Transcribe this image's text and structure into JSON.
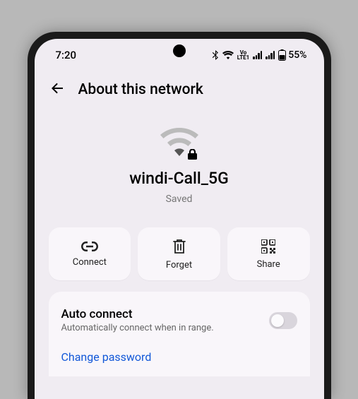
{
  "statusbar": {
    "time": "7:20",
    "battery_pct": "55%"
  },
  "header": {
    "title": "About this network"
  },
  "network": {
    "name": "windi-Call_5G",
    "status": "Saved"
  },
  "actions": {
    "connect": "Connect",
    "forget": "Forget",
    "share": "Share"
  },
  "settings": {
    "auto_connect": {
      "title": "Auto connect",
      "subtitle": "Automatically connect when in range.",
      "enabled": false
    },
    "change_password": "Change password"
  }
}
